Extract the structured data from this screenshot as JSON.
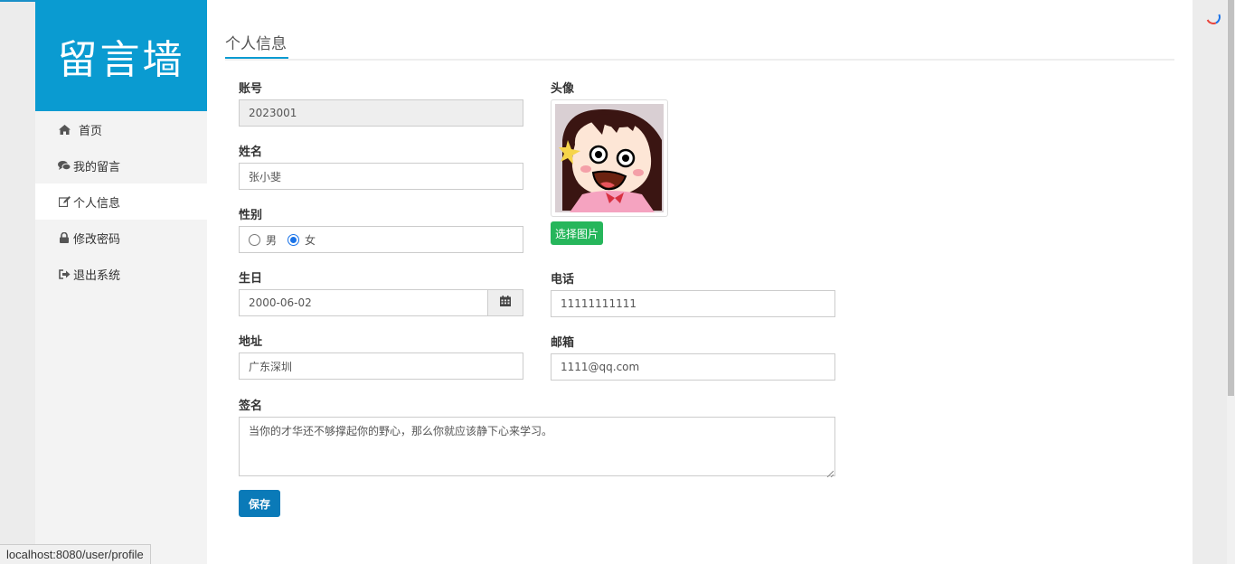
{
  "app": {
    "logo_text": "留言墙"
  },
  "sidebar": {
    "items": [
      {
        "label": "首页",
        "icon": "home-icon",
        "active": false
      },
      {
        "label": "我的留言",
        "icon": "comments-icon",
        "active": false
      },
      {
        "label": "个人信息",
        "icon": "edit-icon",
        "active": true
      },
      {
        "label": "修改密码",
        "icon": "lock-icon",
        "active": false
      },
      {
        "label": "退出系统",
        "icon": "sign-out-icon",
        "active": false
      }
    ]
  },
  "page": {
    "title": "个人信息"
  },
  "form": {
    "account": {
      "label": "账号",
      "value": "2023001"
    },
    "name": {
      "label": "姓名",
      "value": "张小斐"
    },
    "gender": {
      "label": "性别",
      "option_male": "男",
      "option_female": "女",
      "selected": "女"
    },
    "birthday": {
      "label": "生日",
      "value": "2000-06-02"
    },
    "address": {
      "label": "地址",
      "value": "广东深圳"
    },
    "avatar": {
      "label": "头像",
      "button": "选择图片"
    },
    "phone": {
      "label": "电话",
      "value": "11111111111"
    },
    "email": {
      "label": "邮箱",
      "value": "1111@qq.com"
    },
    "signature": {
      "label": "签名",
      "value": "当你的才华还不够撑起你的野心，那么你就应该静下心来学习。"
    },
    "save_label": "保存"
  },
  "statusbar": {
    "url": "localhost:8080/user/profile"
  },
  "colors": {
    "brand": "#0a9bd1",
    "primary_button": "#0a7ab8",
    "success_button": "#26b65b"
  }
}
